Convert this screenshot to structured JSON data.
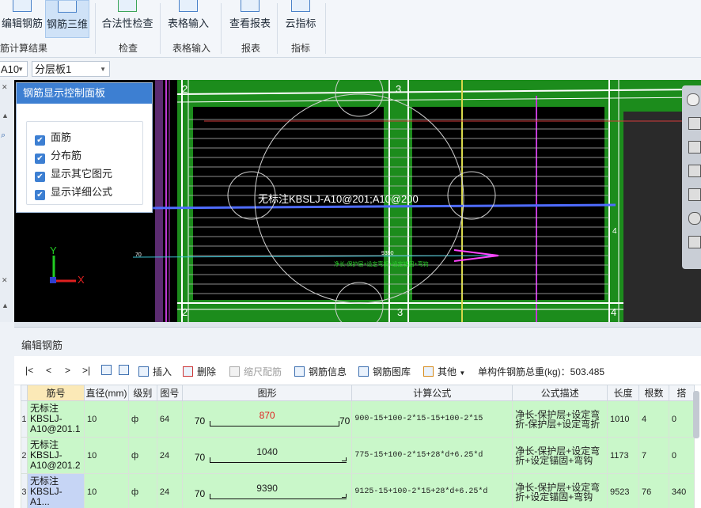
{
  "ribbon": {
    "buttons": [
      {
        "label": "编辑钢筋"
      },
      {
        "label": "钢筋三维"
      },
      {
        "label": "合法性检查"
      },
      {
        "label": "表格输入"
      },
      {
        "label": "查看报表"
      },
      {
        "label": "云指标"
      }
    ],
    "groups": [
      "筋计算结果",
      "检查",
      "表格输入",
      "报表",
      "指标"
    ]
  },
  "toolbar2": {
    "combo1": "A10",
    "combo2": "分层板1"
  },
  "viewport": {
    "label_main": "无标注KBSLJ-A10@201;A10@200",
    "dim_9390": "9390",
    "small_text": "净长-保护层+设定弯折+设定锚固+弯钩",
    "grid_labels": [
      "2",
      "3",
      "3",
      "4",
      "2",
      "4"
    ],
    "axis_x": "X",
    "axis_y": "Y",
    "left_70": "70"
  },
  "control_panel": {
    "title": "钢筋显示控制面板",
    "options": [
      {
        "label": "面筋",
        "checked": true
      },
      {
        "label": "分布筋",
        "checked": true
      },
      {
        "label": "显示其它图元",
        "checked": true
      },
      {
        "label": "显示详细公式",
        "checked": true
      }
    ]
  },
  "editor": {
    "title": "编辑钢筋",
    "nav": [
      "|<",
      "<",
      ">",
      ">|"
    ],
    "tools": {
      "insert": "插入",
      "delete": "删除",
      "scale": "缩尺配筋",
      "info": "钢筋信息",
      "library": "钢筋图库",
      "other": "其他",
      "total": "单构件钢筋总重(kg)：503.485"
    },
    "columns": [
      "筋号",
      "直径(mm)",
      "级别",
      "图号",
      "图形",
      "计算公式",
      "公式描述",
      "长度",
      "根数",
      "搭"
    ],
    "rows": [
      {
        "n": "1",
        "name": "无标注\nKBSLJ-\nA10@201.1",
        "dia": "10",
        "grade": "ф",
        "fig": "64",
        "shape_left": "70",
        "shape_mid": "870",
        "shape_right": "70",
        "formula": "900-15+100-2*15-15+100-2*15",
        "desc": "净长-保护层+设定弯折-保护层+设定弯折",
        "len": "1010",
        "count": "4",
        "lap": "0"
      },
      {
        "n": "2",
        "name": "无标注\nKBSLJ-\nA10@201.2",
        "dia": "10",
        "grade": "ф",
        "fig": "24",
        "shape_left": "70",
        "shape_mid": "1040",
        "shape_right": "",
        "formula": "775-15+100-2*15+28*d+6.25*d",
        "desc": "净长-保护层+设定弯折+设定锚固+弯钩",
        "len": "1173",
        "count": "7",
        "lap": "0"
      },
      {
        "n": "3",
        "name": "无标注\nKBSLJ-A1...",
        "dia": "10",
        "grade": "ф",
        "fig": "24",
        "shape_left": "70",
        "shape_mid": "9390",
        "shape_right": "",
        "formula": "9125-15+100-2*15+28*d+6.25*d",
        "desc": "净长-保护层+设定弯折+设定锚固+弯钩",
        "len": "9523",
        "count": "76",
        "lap": "340"
      }
    ]
  }
}
